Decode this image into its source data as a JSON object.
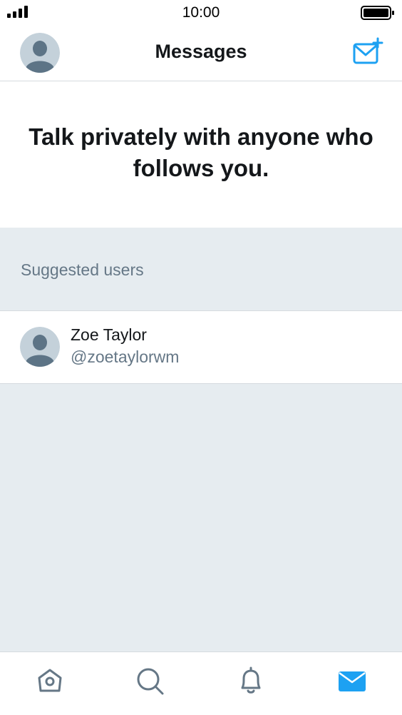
{
  "status_bar": {
    "time": "10:00"
  },
  "header": {
    "title": "Messages",
    "avatar_icon": "default-avatar-icon",
    "compose_icon": "new-message-icon"
  },
  "empty_state": {
    "headline": "Talk privately with anyone who follows you."
  },
  "suggested": {
    "label": "Suggested users",
    "users": [
      {
        "name": "Zoe Taylor",
        "handle": "@zoetaylorwm"
      }
    ]
  },
  "tab_bar": {
    "tabs": [
      {
        "icon": "home-icon",
        "active": false
      },
      {
        "icon": "search-icon",
        "active": false
      },
      {
        "icon": "notifications-bell-icon",
        "active": false
      },
      {
        "icon": "messages-envelope-icon",
        "active": true
      }
    ]
  },
  "colors": {
    "accent": "#1da1f2",
    "icon_inactive": "#657786",
    "secondary_text": "#657786",
    "background": "#e6ecf0",
    "avatar_bg": "#c4d1da",
    "avatar_fg": "#5d7486"
  }
}
